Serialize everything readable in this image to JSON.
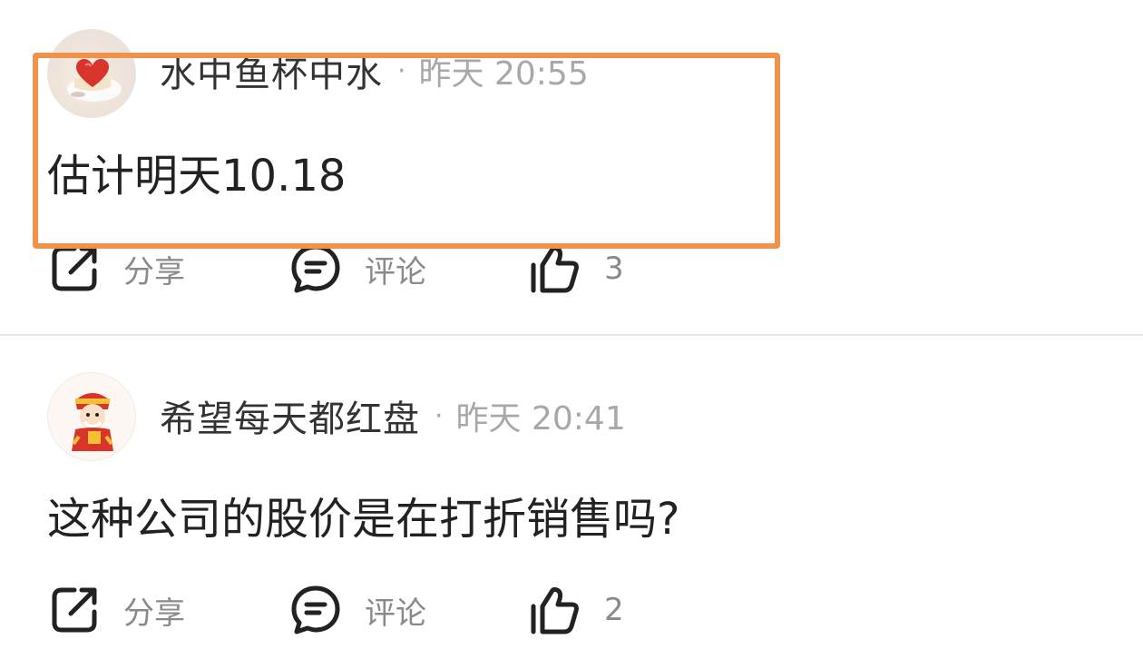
{
  "posts": [
    {
      "username": "水中鱼杯中水",
      "separator": "·",
      "time": "昨天 20:55",
      "content": "估计明天10.18",
      "avatar_icon": "heart-cake-avatar",
      "actions": {
        "share_label": "分享",
        "comment_label": "评论",
        "like_count": "3"
      }
    },
    {
      "username": "希望每天都红盘",
      "separator": "·",
      "time": "昨天 20:41",
      "content": "这种公司的股价是在打折销售吗?",
      "avatar_icon": "fortune-god-avatar",
      "actions": {
        "share_label": "分享",
        "comment_label": "评论",
        "like_count": "2"
      }
    }
  ],
  "colors": {
    "highlight_border": "#f0924a",
    "username": "#333333",
    "time": "#a8a8a8",
    "content": "#222222",
    "action_label": "#8a8a8a"
  }
}
